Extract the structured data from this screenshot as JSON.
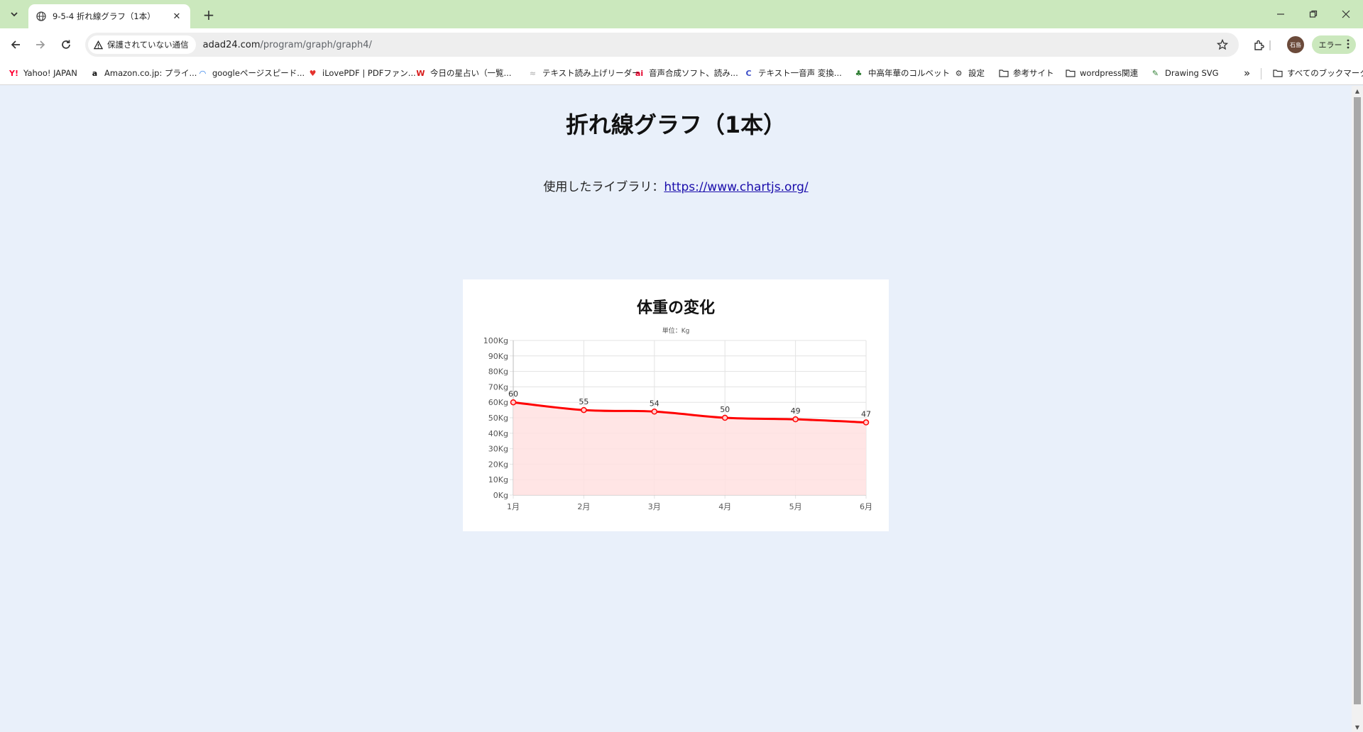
{
  "browser": {
    "tab_title": "9-5-4 折れ線グラフ（1本）",
    "security_label": "保護されていない通信",
    "url_host": "adad24.com",
    "url_path": "/program/graph/graph4/",
    "profile_initials": "石島",
    "error_label": "エラー"
  },
  "bookmarks": [
    {
      "label": "Yahoo! JAPAN",
      "icon": "Y!",
      "color": "#ff0033"
    },
    {
      "label": "Amazon.co.jp: プライ...",
      "icon": "a",
      "color": "#111111"
    },
    {
      "label": "googleページスピード...",
      "icon": "◠",
      "color": "#1a73e8"
    },
    {
      "label": "iLovePDF | PDFファン...",
      "icon": "♥",
      "color": "#e5322d"
    },
    {
      "label": "今日の星占い（一覧...",
      "icon": "W",
      "color": "#d81b1b"
    },
    {
      "label": "テキスト読み上げリーダー",
      "icon": "≈",
      "color": "#bbbbbb"
    },
    {
      "label": "音声合成ソフト、読み...",
      "icon": "ai",
      "color": "#e4002b"
    },
    {
      "label": "テキスト一音声 変換...",
      "icon": "C",
      "color": "#3c4ec8"
    },
    {
      "label": "中高年華のコルベット",
      "icon": "♣",
      "color": "#2e7d32"
    },
    {
      "label": "設定",
      "icon": "⚙",
      "color": "#333333"
    },
    {
      "label": "参考サイト",
      "icon": "folder",
      "color": "#333333"
    },
    {
      "label": "wordpress関連",
      "icon": "folder",
      "color": "#333333"
    },
    {
      "label": "Drawing SVG",
      "icon": "✎",
      "color": "#2e7d32"
    }
  ],
  "all_bookmarks_label": "すべてのブックマーク",
  "page": {
    "title": "折れ線グラフ（1本）",
    "library_prefix": "使用したライブラリ：",
    "library_link": "https://www.chartjs.org/"
  },
  "chart_data": {
    "type": "line",
    "title": "体重の変化",
    "subtitle": "単位：Kg",
    "categories": [
      "1月",
      "2月",
      "3月",
      "4月",
      "5月",
      "6月"
    ],
    "series": [
      {
        "values": [
          60,
          55,
          54,
          50,
          49,
          47
        ],
        "color": "#ff0000",
        "fill": "#ffe0e0"
      }
    ],
    "ylim": [
      0,
      100
    ],
    "y_tick_step": 10,
    "y_tick_suffix": "Kg",
    "grid": true,
    "data_labels": true
  }
}
